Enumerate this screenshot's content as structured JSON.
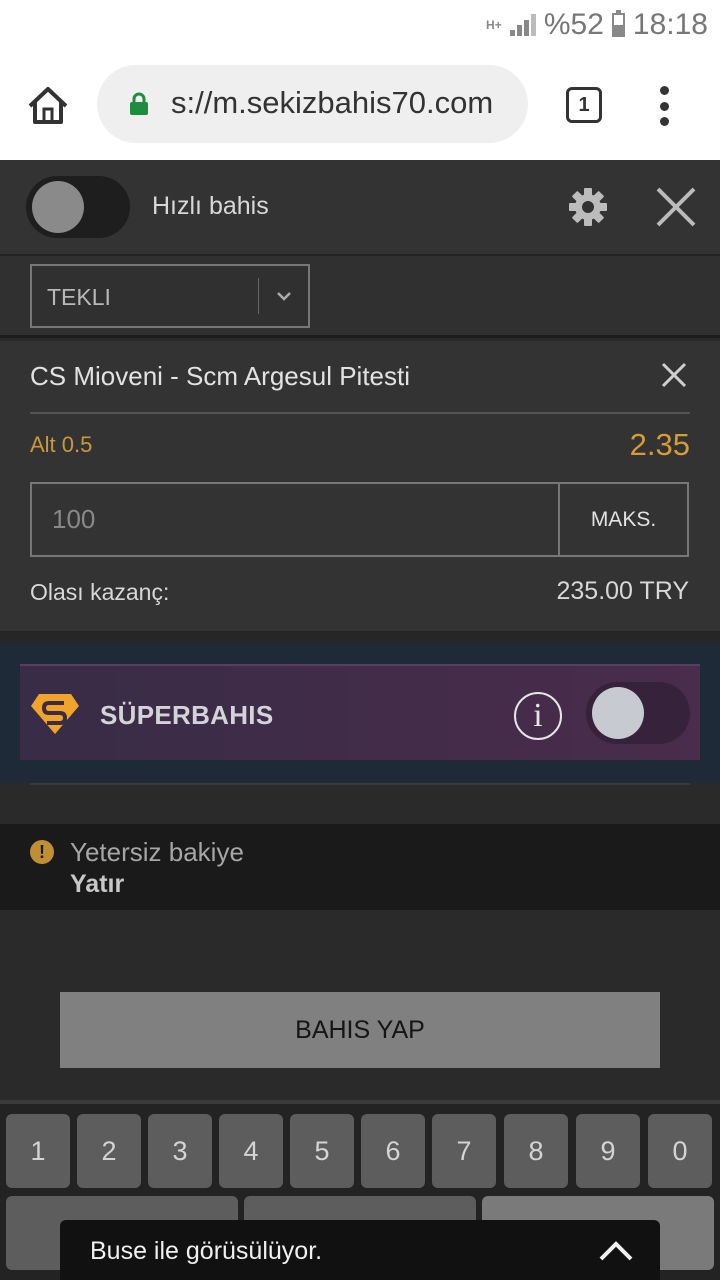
{
  "status_bar": {
    "network": "H+",
    "battery": "%52",
    "time": "18:18"
  },
  "browser": {
    "url": "s://m.sekizbahis70.com",
    "tab_count": "1",
    "icons": [
      "home-icon",
      "lock-icon",
      "tabs-icon",
      "more-vert-icon"
    ]
  },
  "betslip": {
    "quick_bet_label": "Hızlı bahis",
    "bet_type": "TEKLI",
    "match": "CS Mioveni - Scm Argesul Pitesti",
    "market": "Alt 0.5",
    "odds": "2.35",
    "stake_placeholder": "100",
    "max_label": "MAKS.",
    "potential_win_label": "Olası kazanç:",
    "potential_win_value": "235.00 TRY"
  },
  "superbahis": {
    "title": "SÜPERBAHIS",
    "info_glyph": "i"
  },
  "warning": {
    "message": "Yetersiz bakiye",
    "link": "Yatır"
  },
  "place_bet_label": "BAHIS YAP",
  "keyboard": {
    "digits": [
      "1",
      "2",
      "3",
      "4",
      "5",
      "6",
      "7",
      "8",
      "9",
      "0"
    ]
  },
  "toast": {
    "text": "Buse ile görüsülüyor."
  },
  "colors": {
    "accent_odds": "#d49d36",
    "panel_bg": "#333333",
    "superbahis_gradient": "#4a2c4c"
  }
}
